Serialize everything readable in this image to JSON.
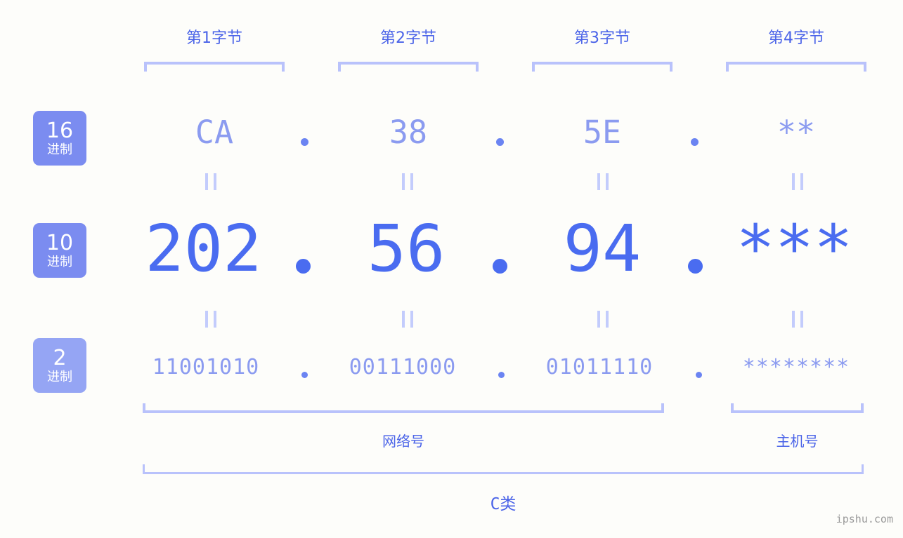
{
  "colors": {
    "background": "#fdfdfa",
    "accent_strong": "#4a6cf0",
    "accent_label": "#4a63e8",
    "accent_light": "#8b9bf0",
    "bracket": "#b9c2fb",
    "badge": "#7b8cf0",
    "badge_light": "#95a5f4",
    "watermark": "#9a9a9a"
  },
  "byte_headers": [
    {
      "label": "第1字节"
    },
    {
      "label": "第2字节"
    },
    {
      "label": "第3字节"
    },
    {
      "label": "第4字节"
    }
  ],
  "bases": [
    {
      "num": "16",
      "unit": "进制"
    },
    {
      "num": "10",
      "unit": "进制"
    },
    {
      "num": "2",
      "unit": "进制"
    }
  ],
  "rows": {
    "hex": {
      "values": [
        "CA",
        "38",
        "5E",
        "**"
      ]
    },
    "decimal": {
      "values": [
        "202",
        "56",
        "94",
        "***"
      ]
    },
    "binary": {
      "values": [
        "11001010",
        "00111000",
        "01011110",
        "********"
      ]
    }
  },
  "separators": {
    "hex": [
      ".",
      ".",
      "."
    ],
    "decimal": [
      ".",
      ".",
      "."
    ],
    "binary": [
      ".",
      ".",
      "."
    ]
  },
  "equivalence": {
    "glyph": "="
  },
  "sections": [
    {
      "label": "网络号"
    },
    {
      "label": "主机号"
    }
  ],
  "ip_class": {
    "label": "C类"
  },
  "watermark": {
    "text": "ipshu.com"
  }
}
